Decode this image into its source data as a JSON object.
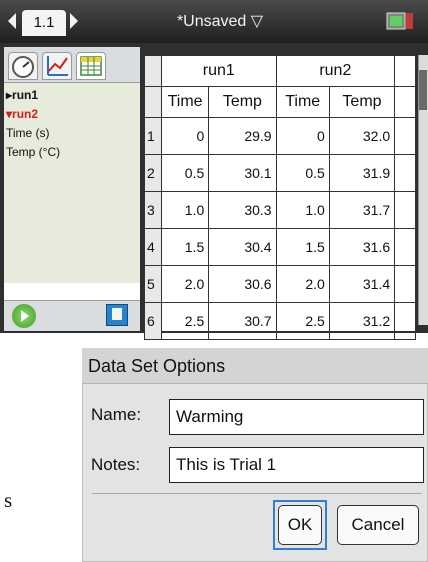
{
  "topbar": {
    "page_tab": "1.1",
    "doc_title": "*Unsaved ▽"
  },
  "left_panel": {
    "variables": [
      {
        "label": "▸run1"
      },
      {
        "label": "▾ru n2"
      },
      {
        "label": "Time (s)"
      },
      {
        "label": "Temp (°C)"
      }
    ]
  },
  "table": {
    "groups": [
      "run1",
      "run2"
    ],
    "columns": [
      "Time",
      "Temp",
      "Time",
      "Temp"
    ],
    "rows": [
      {
        "n": "1",
        "cells": [
          "0",
          "29.9",
          "0",
          "32.0"
        ]
      },
      {
        "n": "2",
        "cells": [
          "0.5",
          "30.1",
          "0.5",
          "31.9"
        ]
      },
      {
        "n": "3",
        "cells": [
          "1.0",
          "30.3",
          "1.0",
          "31.7"
        ]
      },
      {
        "n": "4",
        "cells": [
          "1.5",
          "30.4",
          "1.5",
          "31.6"
        ]
      },
      {
        "n": "5",
        "cells": [
          "2.0",
          "30.6",
          "2.0",
          "31.4"
        ]
      },
      {
        "n": "6",
        "cells": [
          "2.5",
          "30.7",
          "2.5",
          "31.2"
        ]
      }
    ]
  },
  "dialog": {
    "title": "Data Set Options",
    "name_label": "Name:",
    "name_value": "Warming",
    "notes_label": "Notes:",
    "notes_value": "This is Trial 1",
    "ok_label": "OK",
    "cancel_label": "Cancel"
  },
  "stray_text": "s",
  "colors": {
    "selected_run": "#d21f1f",
    "focus": "#2f7fd4",
    "varlist_bg": "#e7ebdc"
  }
}
